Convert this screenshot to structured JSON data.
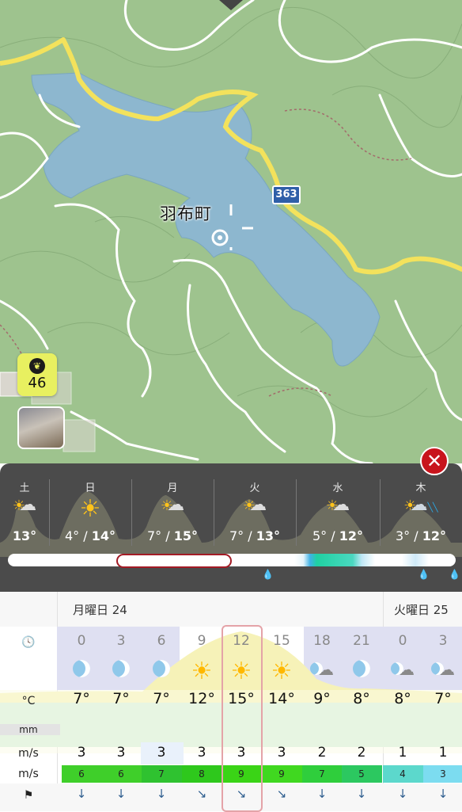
{
  "map": {
    "place_name": "羽布町",
    "route_number": "363",
    "air_quality_value": "46",
    "air_quality_icon": "leaf-icon"
  },
  "daily": [
    {
      "name": "土",
      "low": "",
      "high": "13°",
      "icon": "sun-cloud-icon"
    },
    {
      "name": "日",
      "low": "4° / ",
      "high": "14°",
      "icon": "sun-icon"
    },
    {
      "name": "月",
      "low": "7° / ",
      "high": "15°",
      "icon": "sun-cloud-icon"
    },
    {
      "name": "火",
      "low": "7° / ",
      "high": "13°",
      "icon": "sun-cloud-icon"
    },
    {
      "name": "水",
      "low": "5° / ",
      "high": "12°",
      "icon": "sun-cloud-icon"
    },
    {
      "name": "木",
      "low": "3° / ",
      "high": "12°",
      "icon": "sun-rain-cloud-icon"
    }
  ],
  "hourly": {
    "date1": "月曜日 24",
    "date2": "火曜日 25",
    "units": {
      "clock_icon": "clock-icon",
      "temp": "°C",
      "precip": "mm",
      "wind": "m/s",
      "gust": "m/s",
      "direction_icon": "windsock-icon"
    },
    "hours": [
      "0",
      "3",
      "6",
      "9",
      "12",
      "15",
      "18",
      "21",
      "0",
      "3"
    ],
    "icons": [
      "moon-icon",
      "moon-icon",
      "moon-icon",
      "sun-icon",
      "sun-icon",
      "sun-icon",
      "moon-cloud-icon",
      "moon-icon",
      "moon-cloud-icon",
      "moon-cloud-icon"
    ],
    "temps": [
      "7°",
      "7°",
      "7°",
      "12°",
      "15°",
      "14°",
      "9°",
      "8°",
      "8°",
      "7°"
    ],
    "wind": [
      "3",
      "3",
      "3",
      "3",
      "3",
      "3",
      "2",
      "2",
      "1",
      "1"
    ],
    "gust": [
      "6",
      "6",
      "7",
      "8",
      "9",
      "9",
      "7",
      "5",
      "4",
      "3"
    ],
    "gust_colors": [
      "#3fcf2a",
      "#3fcf2a",
      "#2fc230",
      "#2ec81c",
      "#3ad416",
      "#40d820",
      "#2fce3c",
      "#2cc860",
      "#5cd8cc",
      "#7cdcf0"
    ]
  },
  "accent": "#c8141c"
}
